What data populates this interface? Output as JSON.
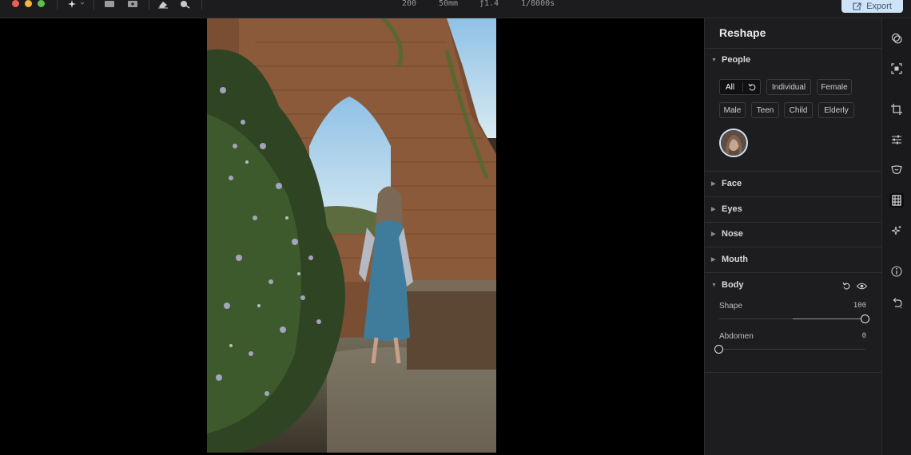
{
  "window": {
    "traffic_lights": {
      "close": "#ee5c55",
      "minimize": "#f2b73c",
      "zoom": "#5ec24a"
    }
  },
  "toolbar": {
    "tools": [
      {
        "icon": "magic-wand-icon",
        "has_dropdown": true
      },
      {
        "icon": "compare-icon"
      },
      {
        "icon": "add-photo-icon"
      },
      {
        "icon": "eraser-icon"
      },
      {
        "icon": "zoom-icon"
      }
    ],
    "exif": {
      "iso": "200",
      "focal_length": "50mm",
      "aperture": "ƒ1.4",
      "shutter": "1/8000s"
    },
    "export_label": "Export",
    "accent_color": "#cfe3f7"
  },
  "panel": {
    "title": "Reshape",
    "people": {
      "label": "People",
      "expanded": true,
      "filters_row1": [
        "All",
        "Individual",
        "Female"
      ],
      "filters_row2": [
        "Male",
        "Teen",
        "Child",
        "Elderly"
      ],
      "selected_filter": "All"
    },
    "sections": {
      "face": "Face",
      "eyes": "Eyes",
      "nose": "Nose",
      "mouth": "Mouth"
    },
    "body": {
      "label": "Body",
      "expanded": true,
      "sliders": [
        {
          "label": "Shape",
          "value": "100",
          "level": 1.0,
          "default": 0.5
        },
        {
          "label": "Abdomen",
          "value": "0",
          "level": 0.0,
          "default": 0.0
        }
      ]
    }
  },
  "rail": {
    "icons": [
      "layers-icon",
      "select-subject-icon",
      "crop-icon",
      "adjustments-icon",
      "retouch-icon",
      "reshape-body-icon",
      "ai-enhance-icon",
      "info-icon",
      "undo-history-icon"
    ],
    "active": "reshape-body-icon"
  }
}
